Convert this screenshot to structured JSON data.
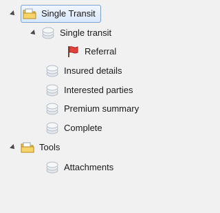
{
  "tree": {
    "nodes": [
      {
        "label": "Single Transit",
        "icon": "folder-icon"
      },
      {
        "label": "Single transit",
        "icon": "doc-stack-icon"
      },
      {
        "label": "Referral",
        "icon": "red-flag-icon"
      },
      {
        "label": "Insured details",
        "icon": "doc-stack-icon"
      },
      {
        "label": "Interested parties",
        "icon": "doc-stack-icon"
      },
      {
        "label": "Premium summary",
        "icon": "doc-stack-icon"
      },
      {
        "label": "Complete",
        "icon": "doc-stack-icon"
      },
      {
        "label": "Tools",
        "icon": "folder-icon"
      },
      {
        "label": "Attachments",
        "icon": "doc-stack-icon"
      }
    ]
  },
  "colors": {
    "background": "#f1f1f1",
    "selection_border": "#7da2ce",
    "folder": "#f2c247",
    "flag": "#e0413a"
  }
}
